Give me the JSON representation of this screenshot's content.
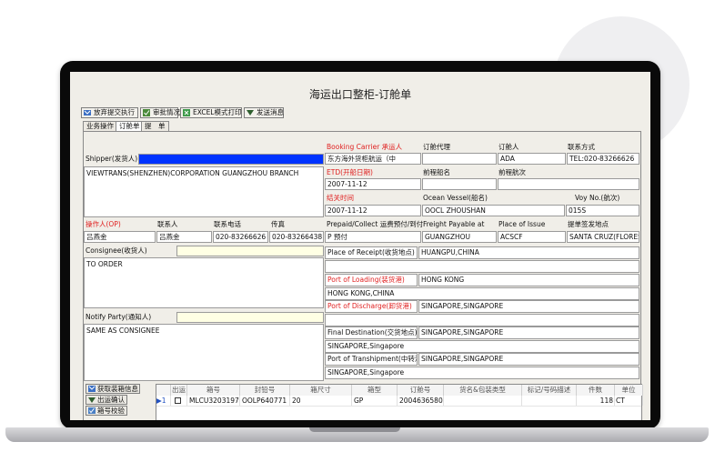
{
  "window_title": "海运出口整柜-订舱单",
  "toolbar": [
    {
      "label": "放弃提交执行",
      "icon": "send-icon"
    },
    {
      "label": "审批情况",
      "icon": "approve-icon"
    },
    {
      "label": "EXCEL模式打印",
      "icon": "excel-print-icon"
    },
    {
      "label": "发送消息",
      "icon": "message-icon"
    }
  ],
  "tabs": [
    {
      "label": "业务操作",
      "active": false
    },
    {
      "label": "订舱单",
      "active": true
    },
    {
      "label": "提　单",
      "active": false
    }
  ],
  "shipper": {
    "label": "Shipper(发货人)",
    "value": "",
    "text": "VIEWTRANS(SHENZHEN)CORPORATION GUANGZHOU BRANCH"
  },
  "booking": {
    "carrier_label": "Booking Carrier 承运人",
    "carrier_value": "东方海外货柜航运（中",
    "agent_label": "订舱代理",
    "agent_value": "",
    "booker_label": "订舱人",
    "booker_value": "ADA",
    "contact_label": "联系方式",
    "contact_value": "TEL:020-83266626"
  },
  "etd": {
    "label": "ETD(开船日期)",
    "value": "2007-11-12",
    "prev_vessel_label": "前程船名",
    "prev_vessel_value": "",
    "prev_voyage_label": "前程航次",
    "prev_voyage_value": ""
  },
  "cutoff": {
    "label": "结关时间",
    "value": "2007-11-12",
    "vessel_label": "Ocean Vessel(船名)",
    "vessel_value": "OOCL ZHOUSHAN",
    "voyage_label": "Voy No.(航次)",
    "voyage_value": "015S"
  },
  "op_row": {
    "op_label": "操作人(OP)",
    "op_value": "吕燕金",
    "contact_label": "联系人",
    "contact_value": "吕燕金",
    "phone_label": "联系电话",
    "phone_value": "020-83266626",
    "fax_label": "传真",
    "fax_value": "020-83266438",
    "prepaid_label": "Prepaid/Collect 运费预付/到付",
    "prepaid_value": "P 预付",
    "freight_label": "Freight Payable at",
    "freight_value": "GUANGZHOU",
    "issue_label": "Place of Issue",
    "issue_value": "ACSCF",
    "sign_label": "提单签发地点",
    "sign_value": "SANTA CRUZ(FLORES"
  },
  "consignee": {
    "label": "Consignee(收货人)",
    "value": "",
    "text": "TO ORDER"
  },
  "notify": {
    "label": "Notify Party(通知人)",
    "value": "",
    "text": "SAME AS CONSIGNEE"
  },
  "receipt": {
    "label": "Place of Receipt(收货地点)",
    "value": "HUANGPU,CHINA",
    "extra": ""
  },
  "loading": {
    "label": "Port of Loading(装货港)",
    "value": "HONG KONG",
    "extra": "HONG KONG,CHINA"
  },
  "discharge": {
    "label": "Port of  Discharge(卸货港)",
    "value": "SINGAPORE,SINGAPORE",
    "extra": ""
  },
  "final_dest": {
    "label": "Final Destination(交货地点)",
    "value": "SINGAPORE,SINGAPORE",
    "extra": "SINGAPORE,Singapore"
  },
  "transship": {
    "label": "Port of Transhipment(中转港)",
    "value": "SINGAPORE,SINGAPORE",
    "extra": "SINGAPORE,Singapore"
  },
  "side_buttons": [
    {
      "label": "获取装箱信息",
      "icon": "fetch-icon"
    },
    {
      "label": "出运确认",
      "icon": "confirm-icon"
    },
    {
      "label": "箱号校验",
      "icon": "check-icon"
    }
  ],
  "grid": {
    "headers": [
      "出运",
      "箱号",
      "封铅号",
      "箱尺寸",
      "箱型",
      "订舱号",
      "货名&包装类型",
      "标记/号码描述",
      "件数",
      "单位"
    ],
    "rows": [
      {
        "marker": "▶",
        "index": "1",
        "checked": false,
        "box_no": "MLCU3203197",
        "seal": "OOLP640771",
        "size": "20",
        "type": "GP",
        "booking_no": "2004636580",
        "goods": "",
        "marks": "",
        "qty": "118",
        "unit": "CT"
      }
    ]
  },
  "colors": {
    "accent_red": "#e02020",
    "shipper_highlight": "#0033ff",
    "input_yellow": "#ffffe4"
  }
}
